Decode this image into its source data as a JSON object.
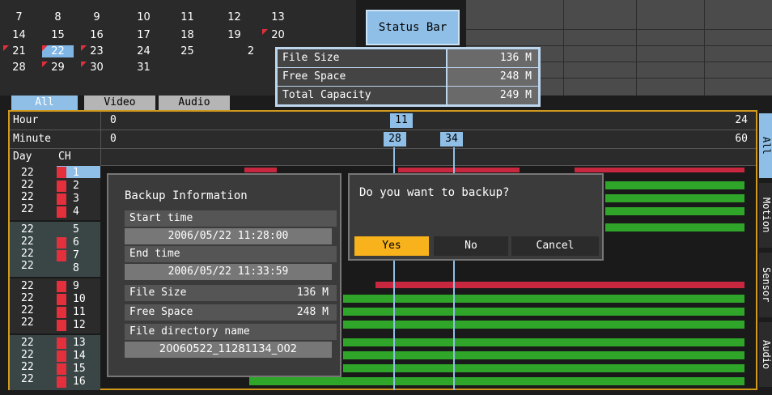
{
  "calendar": {
    "rows": [
      [
        "7",
        "8",
        "9",
        "10",
        "11",
        "12",
        "13"
      ],
      [
        "14",
        "15",
        "16",
        "17",
        "18",
        "19",
        "20"
      ],
      [
        "21",
        "22",
        "23",
        "24",
        "25",
        "2"
      ],
      [
        "28",
        "29",
        "30",
        "31"
      ]
    ],
    "selected": "22"
  },
  "status_button": "Status Bar",
  "status_popup": {
    "rows": [
      {
        "label": "File Size",
        "value": "136 M"
      },
      {
        "label": "Free Space",
        "value": "248 M"
      },
      {
        "label": "Total Capacity",
        "value": "249 M"
      }
    ]
  },
  "tabs": [
    "All",
    "Video",
    "Audio"
  ],
  "timeline": {
    "hour_label": "Hour",
    "hour_start": "0",
    "hour_end": "24",
    "hour_marker": "11",
    "minute_label": "Minute",
    "minute_start": "0",
    "minute_end": "60",
    "minute_marker_a": "28",
    "minute_marker_b": "34",
    "day_header": "Day",
    "ch_header": "CH",
    "channels": [
      "1",
      "2",
      "3",
      "4",
      "5",
      "6",
      "7",
      "8",
      "9",
      "10",
      "11",
      "12",
      "13",
      "14",
      "15",
      "16"
    ],
    "day": "22"
  },
  "side_tabs": [
    "All",
    "Motion",
    "Sensor",
    "Audio"
  ],
  "backup_info": {
    "title": "Backup Information",
    "start_label": "Start time",
    "start_value": "2006/05/22  11:28:00",
    "end_label": "End time",
    "end_value": "2006/05/22  11:33:59",
    "file_size_label": "File Size",
    "file_size_value": "136 M",
    "free_space_label": "Free Space",
    "free_space_value": "248 M",
    "dir_label": "File directory name",
    "dir_value": "20060522_11281134_002"
  },
  "confirm": {
    "question": "Do you want to backup?",
    "yes": "Yes",
    "no": "No",
    "cancel": "Cancel"
  },
  "colors": {
    "accent": "#8fbfe6",
    "selected_button": "#f7b21c",
    "record_red": "#c8283f",
    "record_green": "#2fa52a",
    "frame": "#d29a1c"
  }
}
